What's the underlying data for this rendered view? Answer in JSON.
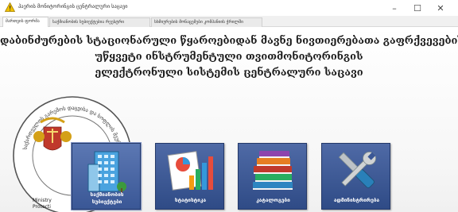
{
  "window": {
    "title": "ჰაერის მონიტორინგის ცენტრალური საცავი",
    "minimize_glyph": "–",
    "maximize_glyph": "☐",
    "close_glyph": "✕",
    "icon": "warning-triangle-icon"
  },
  "tabs": [
    {
      "label": "მართვის ფორმა",
      "active": true
    },
    {
      "label": "საქმიანობის სუბიექტებია რეესტრი",
      "active": false
    },
    {
      "label": "სხმიურების მონაცემები კომპანიის ჭრილში",
      "active": false
    }
  ],
  "heading": {
    "line1": "დაბინძურების სტაციონარული წყაროებიდან მავნე ნივთიერებათა გაფრქვევების",
    "line2": "უწყვეტი ინსტრუმენტული თვითმონიტორინგის",
    "line3": "ელექტრონული სისტემის ცენტრალური საცავი"
  },
  "seal": {
    "ring_text": "საქართველოს გარემოს დაცვისა და სოფლის მეურნეობის სამინისტრო",
    "inner_text_1": "Ministry",
    "inner_text_2": "Protecti"
  },
  "tiles": [
    {
      "line1": "საქმიანობის",
      "line2": "სუბიექტები",
      "icon": "office-building-icon"
    },
    {
      "line1": "სტატისტიკა",
      "icon": "statistics-chart-icon"
    },
    {
      "line1": "კატალოგები",
      "icon": "books-stack-icon"
    },
    {
      "line1": "ადმინისტრირება",
      "icon": "wrench-screwdriver-icon"
    }
  ],
  "colors": {
    "tile_blue": "#3a5796",
    "warning_yellow": "#f2c200",
    "seal_red": "#c0392b"
  }
}
